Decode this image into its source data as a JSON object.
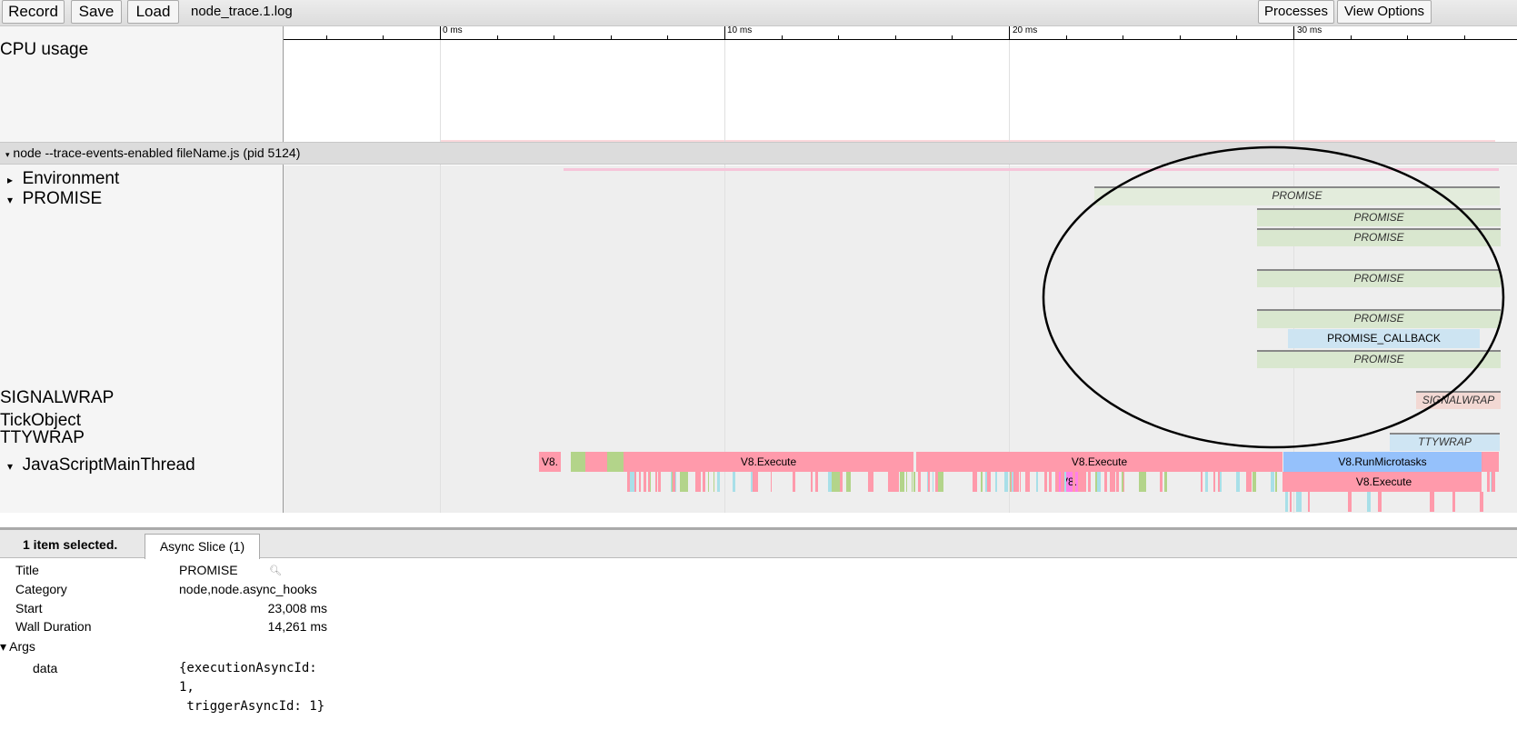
{
  "toolbar": {
    "record": "Record",
    "save": "Save",
    "load": "Load",
    "filename": "node_trace.1.log",
    "processes": "Processes",
    "view_options": "View Options"
  },
  "ruler": {
    "labels": [
      "0 ms",
      "10 ms",
      "20 ms",
      "30 ms"
    ]
  },
  "tracks": {
    "cpu_label": "CPU usage",
    "process_header": "node --trace-events-enabled fileName.js (pid 5124)",
    "environment": "Environment",
    "promise": "PROMISE",
    "signalwrap": "SIGNALWRAP",
    "tickobject": "TickObject",
    "ttywrap": "TTYWRAP",
    "main_thread": "JavaScriptMainThread"
  },
  "colors": {
    "promise": "#d9e7cf",
    "promise_selected": "#e3ecdc",
    "callback": "#cde4f2",
    "signalwrap": "#f2d8d3",
    "ttywrap": "#cfe5f3",
    "execute": "#ff9aab",
    "microtasks": "#95c1fb",
    "magenta": "#ff80e8",
    "green": "#b3d48a",
    "annotation": "#000000"
  },
  "slices": [
    {
      "row": "p0",
      "title": "PROMISE",
      "start_ms": 23.008,
      "dur_ms": 14.261,
      "color": "promise_selected",
      "async": true
    },
    {
      "row": "p1",
      "title": "PROMISE",
      "start_ms": 28.72,
      "dur_ms": 8.55,
      "color": "promise",
      "async": true
    },
    {
      "row": "p2",
      "title": "PROMISE",
      "start_ms": 28.72,
      "dur_ms": 8.55,
      "color": "promise",
      "async": true
    },
    {
      "row": "p3",
      "title": "PROMISE",
      "start_ms": 28.72,
      "dur_ms": 8.55,
      "color": "promise",
      "async": true
    },
    {
      "row": "p4",
      "title": "PROMISE",
      "start_ms": 28.72,
      "dur_ms": 8.55,
      "color": "promise",
      "async": true
    },
    {
      "row": "p5",
      "title": "PROMISE_CALLBACK",
      "start_ms": 29.81,
      "dur_ms": 6.74,
      "color": "callback",
      "async": false
    },
    {
      "row": "p6",
      "title": "PROMISE",
      "start_ms": 28.72,
      "dur_ms": 8.55,
      "color": "promise",
      "async": true
    },
    {
      "row": "sig",
      "title": "SIGNALWRAP",
      "start_ms": 34.31,
      "dur_ms": 2.96,
      "color": "signalwrap",
      "async": true
    },
    {
      "row": "tty",
      "title": "TTYWRAP",
      "start_ms": 33.39,
      "dur_ms": 3.88,
      "color": "ttywrap",
      "async": true
    },
    {
      "row": "m0",
      "title": "V8.",
      "start_ms": 3.48,
      "dur_ms": 0.77,
      "color": "execute",
      "async": false
    },
    {
      "row": "m0",
      "title": "",
      "start_ms": 4.6,
      "dur_ms": 0.5,
      "color": "green",
      "async": false
    },
    {
      "row": "m0",
      "title": "",
      "start_ms": 5.11,
      "dur_ms": 0.77,
      "color": "execute",
      "async": false
    },
    {
      "row": "m0",
      "title": "",
      "start_ms": 5.88,
      "dur_ms": 0.57,
      "color": "green",
      "async": false
    },
    {
      "row": "m0",
      "title": "V8.Execute",
      "start_ms": 6.45,
      "dur_ms": 10.19,
      "color": "execute",
      "async": false
    },
    {
      "row": "m0",
      "title": "V8.Execute",
      "start_ms": 16.74,
      "dur_ms": 12.87,
      "color": "execute",
      "async": false
    },
    {
      "row": "m0",
      "title": "V8.RunMicrotasks",
      "start_ms": 29.65,
      "dur_ms": 6.96,
      "color": "microtasks",
      "async": false
    },
    {
      "row": "m0",
      "title": "",
      "start_ms": 36.61,
      "dur_ms": 0.6,
      "color": "execute",
      "async": false
    },
    {
      "row": "m1",
      "title": "V8.",
      "start_ms": 21.76,
      "dur_ms": 0.7,
      "color": "magenta",
      "async": false
    },
    {
      "row": "m1",
      "title": "V8.Execute",
      "start_ms": 29.74,
      "dur_ms": 6.87,
      "color": "execute",
      "async": false
    }
  ],
  "details": {
    "selected": "1 item selected.",
    "tab": "Async Slice (1)",
    "rows": [
      {
        "key": "Title",
        "value": "PROMISE"
      },
      {
        "key": "Category",
        "value": "node,node.async_hooks"
      },
      {
        "key": "Start",
        "value": "23,008 ms"
      },
      {
        "key": "Wall Duration",
        "value": "14,261 ms"
      }
    ],
    "args_label": "▾ Args",
    "data_key": "data",
    "data_lines": [
      "{executionAsyncId:",
      "1,",
      " triggerAsyncId: 1}"
    ]
  }
}
